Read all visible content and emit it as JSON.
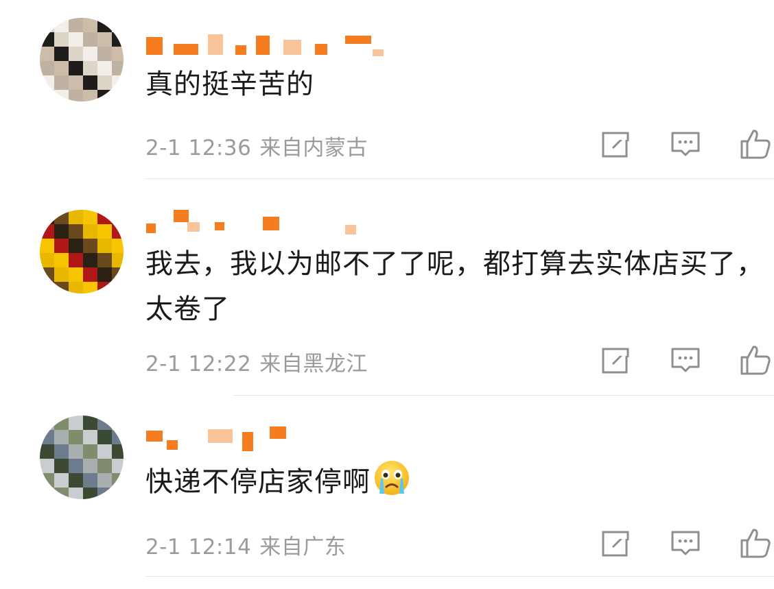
{
  "comments": [
    {
      "username": "",
      "text": "真的挺辛苦的",
      "time": "2-1 12:36",
      "location": "来自内蒙古",
      "avatar_palette": [
        "#ddd5c7",
        "#bfb2a2",
        "#1f1c1c",
        "#f2efeb",
        "#cdbca8"
      ]
    },
    {
      "username": "",
      "text": "我去，我以为邮不了了呢，都打算去实体店买了，太卷了",
      "time": "2-1 12:22",
      "location": "来自黑龙江",
      "avatar_palette": [
        "#f6c400",
        "#2a2014",
        "#e8b800",
        "#b01818",
        "#6a4a1c"
      ]
    },
    {
      "username": "",
      "text": "快递不停店家停啊",
      "time": "2-1 12:14",
      "location": "来自广东",
      "emoji": "crying-face",
      "avatar_palette": [
        "#7e8d6c",
        "#3d4a33",
        "#a9aeae",
        "#c9cdd0",
        "#6c7c8c"
      ]
    }
  ],
  "actions": {
    "share_icon": "share-icon",
    "comment_icon": "comment-icon",
    "like_icon": "like-icon"
  },
  "colors": {
    "username_orange": "#f57c1f",
    "meta_gray": "#9b9b9b",
    "icon_gray": "#8e8e8e"
  }
}
